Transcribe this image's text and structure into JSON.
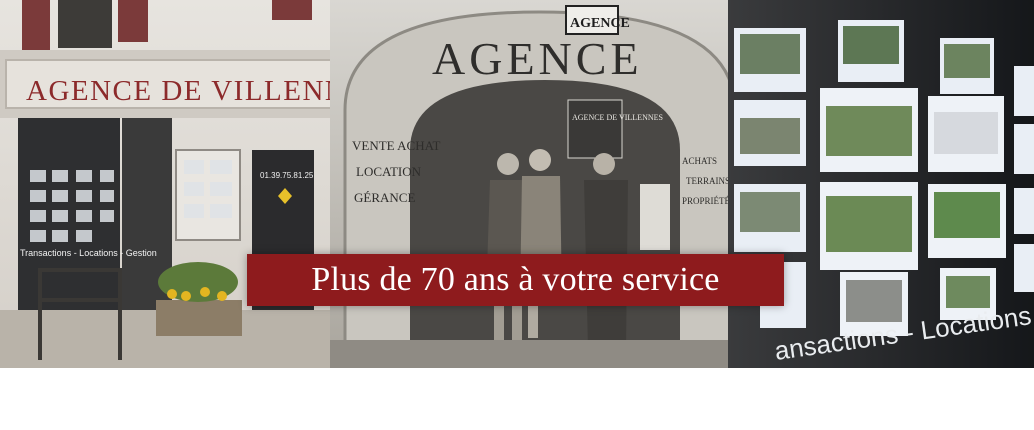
{
  "banner": {
    "storefront_sign": "AGENCE DE VILLENN",
    "vintage_arch_sign": "AGENCE",
    "vintage_roof_sign": "AGENCE",
    "vintage_door_sign": "AGENCE DE VILLENNES",
    "vintage_left_lines": [
      "VENTE ACHAT",
      "LOCATION",
      "GÉRANCE"
    ],
    "vintage_right_lines": [
      "ACHATS",
      "TERRAINS",
      "PROPRIÉTÉS"
    ],
    "storefront_phone": "01.39.75.81.25",
    "storefront_window_band": "Transactions - Locations - Gestion",
    "window_lettering": "ansactions - Locations -",
    "tagline": "Plus de 70 ans à votre service"
  },
  "colors": {
    "caption_bg": "#8e1b1d",
    "sign_red": "#7a1f22"
  }
}
